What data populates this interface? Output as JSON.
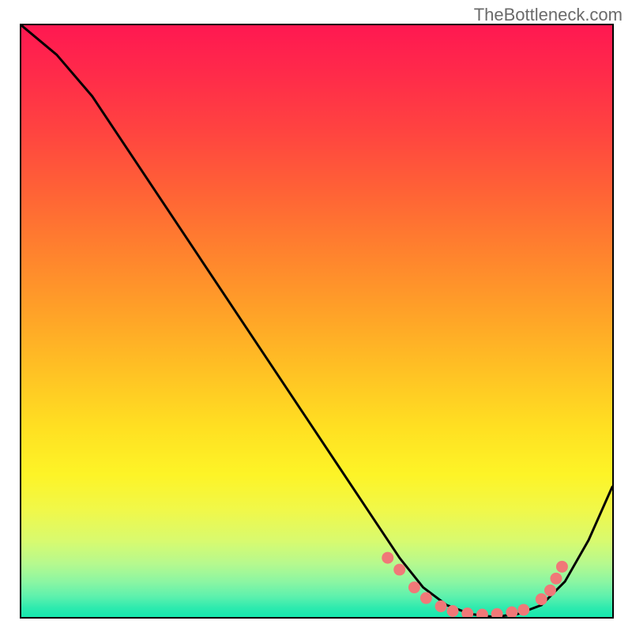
{
  "watermark": "TheBottleneck.com",
  "chart_data": {
    "type": "line",
    "title": "",
    "xlabel": "",
    "ylabel": "",
    "xlim": [
      0,
      100
    ],
    "ylim": [
      0,
      100
    ],
    "grid": false,
    "series": [
      {
        "name": "bottleneck-curve",
        "color": "#000000",
        "x": [
          0,
          6,
          12,
          18,
          24,
          30,
          36,
          42,
          48,
          54,
          60,
          64,
          68,
          72,
          76,
          80,
          84,
          88,
          92,
          96,
          100
        ],
        "values": [
          100,
          95,
          88,
          79,
          70,
          61,
          52,
          43,
          34,
          25,
          16,
          10,
          5,
          2,
          0.5,
          0,
          0.5,
          2,
          6,
          13,
          22
        ]
      }
    ],
    "markers": {
      "name": "dot-cluster",
      "color": "#f07878",
      "radius_pct": 1.0,
      "points": [
        {
          "x": 62,
          "y": 10
        },
        {
          "x": 64,
          "y": 8
        },
        {
          "x": 66.5,
          "y": 5
        },
        {
          "x": 68.5,
          "y": 3.2
        },
        {
          "x": 71,
          "y": 1.8
        },
        {
          "x": 73,
          "y": 1.0
        },
        {
          "x": 75.5,
          "y": 0.6
        },
        {
          "x": 78,
          "y": 0.4
        },
        {
          "x": 80.5,
          "y": 0.5
        },
        {
          "x": 83,
          "y": 0.8
        },
        {
          "x": 85,
          "y": 1.2
        },
        {
          "x": 88,
          "y": 3.0
        },
        {
          "x": 89.5,
          "y": 4.5
        },
        {
          "x": 90.5,
          "y": 6.5
        },
        {
          "x": 91.5,
          "y": 8.5
        }
      ]
    },
    "gradient_stops": [
      {
        "pos": 0.0,
        "color": "#ff1851"
      },
      {
        "pos": 0.5,
        "color": "#ffc024"
      },
      {
        "pos": 0.82,
        "color": "#f0f84a"
      },
      {
        "pos": 1.0,
        "color": "#15e7ad"
      }
    ]
  }
}
